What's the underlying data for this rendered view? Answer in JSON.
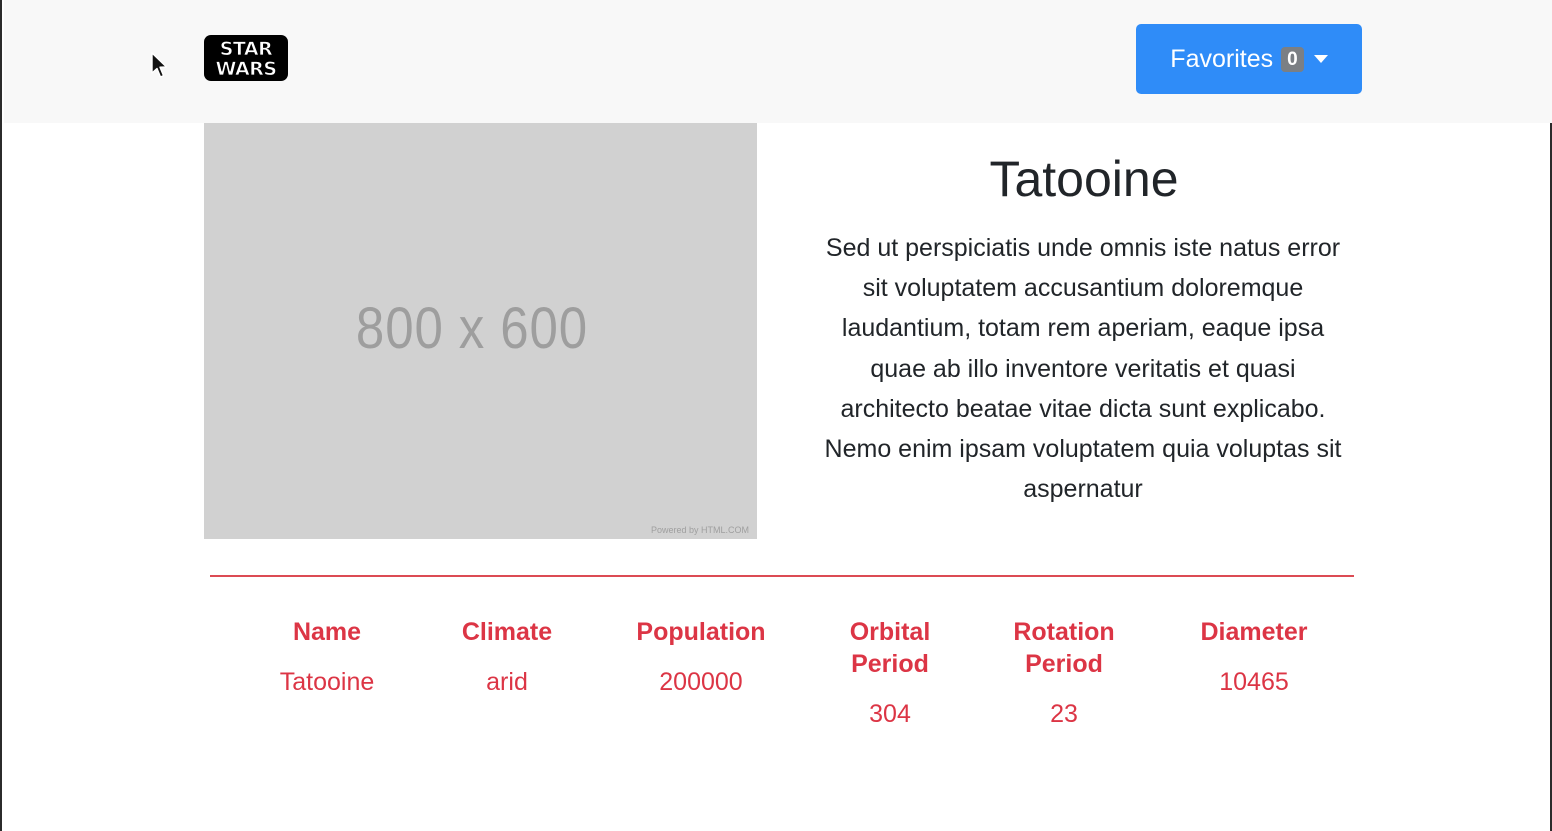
{
  "navbar": {
    "logo_text": "STAR WARS",
    "favorites_button": {
      "label": "Favorites",
      "count": "0"
    }
  },
  "image_placeholder": {
    "text": "800 x 600",
    "powered_by": "Powered by HTML.COM"
  },
  "planet": {
    "title": "Tatooine",
    "description": "Sed ut perspiciatis unde omnis iste natus error sit voluptatem accusantium doloremque laudantium, totam rem aperiam, eaque ipsa quae ab illo inventore veritatis et quasi architecto beatae vitae dicta sunt explicabo. Nemo enim ipsam voluptatem quia voluptas sit aspernatur"
  },
  "stats": [
    {
      "label": "Name",
      "value": "Tatooine"
    },
    {
      "label": "Climate",
      "value": "arid"
    },
    {
      "label": "Population",
      "value": "200000"
    },
    {
      "label": "Orbital Period",
      "value": "304"
    },
    {
      "label": "Rotation Period",
      "value": "23"
    },
    {
      "label": "Diameter",
      "value": "10465"
    }
  ],
  "colors": {
    "primary_button": "#2f8cf8",
    "accent": "#dc3545",
    "placeholder_bg": "#d1d1d1",
    "navbar_bg": "#f8f8f8"
  }
}
